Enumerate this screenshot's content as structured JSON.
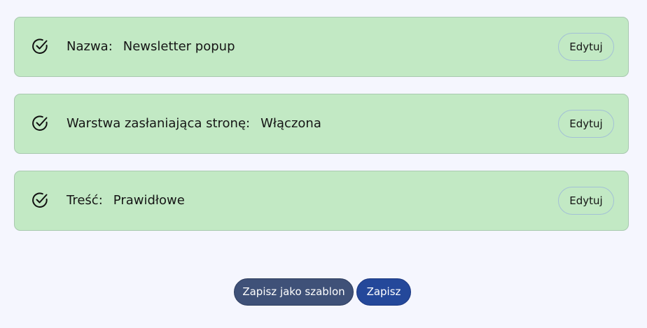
{
  "sections": [
    {
      "label": "Nazwa:",
      "value": "Newsletter popup",
      "edit_label": "Edytuj",
      "status_icon": "check-circle-icon"
    },
    {
      "label": "Warstwa zasłaniająca stronę:",
      "value": "Włączona",
      "edit_label": "Edytuj",
      "status_icon": "check-circle-icon"
    },
    {
      "label": "Treść:",
      "value": "Prawidłowe",
      "edit_label": "Edytuj",
      "status_icon": "check-circle-icon"
    }
  ],
  "footer": {
    "save_as_template_label": "Zapisz jako szablon",
    "save_label": "Zapisz"
  },
  "colors": {
    "page_background": "#f5f6fe",
    "card_background": "#c2e9c4",
    "save_as_template_button": "#3f5178",
    "save_button": "#24489a"
  }
}
